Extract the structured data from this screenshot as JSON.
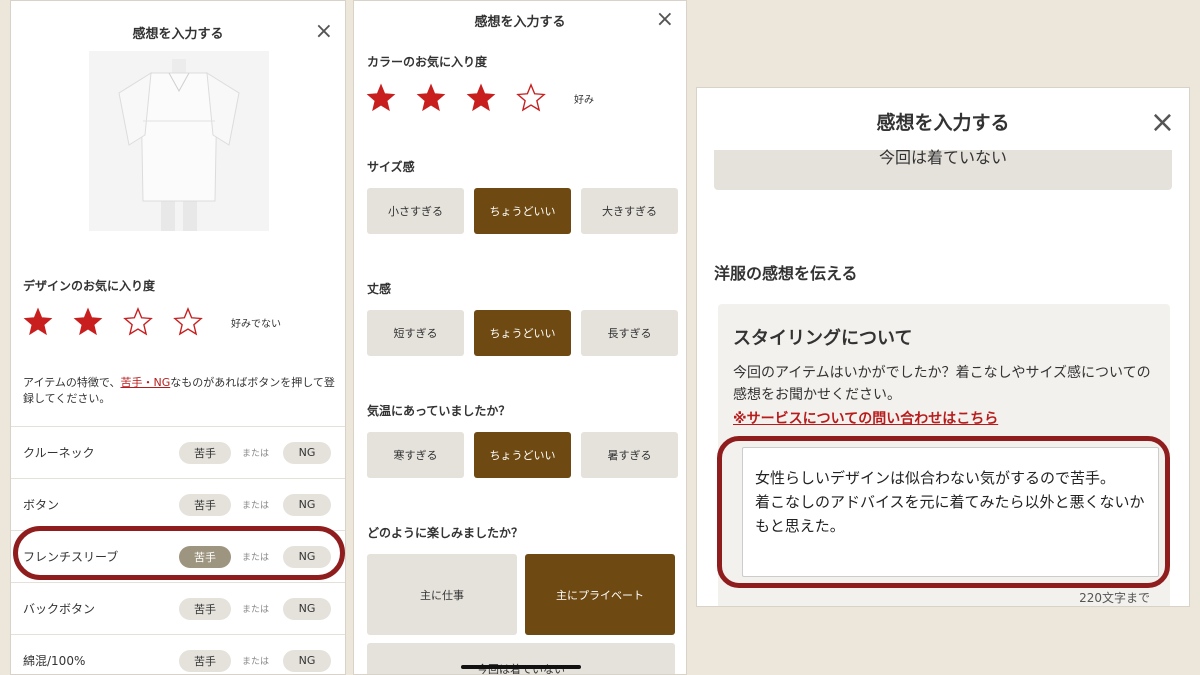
{
  "colors": {
    "background": "#ede6da",
    "star_red": "#c81e1e",
    "active_brown": "#6e4a12",
    "active_pill": "#9e9580",
    "highlight_outline": "#8f1d1d",
    "link_red": "#b71c1c"
  },
  "panel1": {
    "title": "感想を入力する",
    "close_icon": "×",
    "design_rating": {
      "label": "デザインのお気に入り度",
      "value": 2,
      "max": 4,
      "text": "好みでない"
    },
    "note": {
      "prefix": "アイテムの特徴で、",
      "link": "苦手・NG",
      "suffix": "なものがあればボタンを押して登録してください。"
    },
    "features": [
      {
        "name": "クルーネック",
        "nigate": "苦手",
        "or": "または",
        "ng": "NG",
        "selected": ""
      },
      {
        "name": "ボタン",
        "nigate": "苦手",
        "or": "または",
        "ng": "NG",
        "selected": ""
      },
      {
        "name": "フレンチスリーブ",
        "nigate": "苦手",
        "or": "または",
        "ng": "NG",
        "selected": "nigate"
      },
      {
        "name": "バックボタン",
        "nigate": "苦手",
        "or": "または",
        "ng": "NG",
        "selected": ""
      },
      {
        "name": "綿混/100%",
        "nigate": "苦手",
        "or": "または",
        "ng": "NG",
        "selected": ""
      }
    ]
  },
  "panel2": {
    "title": "感想を入力する",
    "close_icon": "×",
    "color_rating": {
      "label": "カラーのお気に入り度",
      "value": 3,
      "max": 4,
      "text": "好み"
    },
    "size": {
      "label": "サイズ感",
      "options": [
        "小さすぎる",
        "ちょうどいい",
        "大きすぎる"
      ],
      "selected": 1
    },
    "length": {
      "label": "丈感",
      "options": [
        "短すぎる",
        "ちょうどいい",
        "長すぎる"
      ],
      "selected": 1
    },
    "temperature": {
      "label": "気温にあっていましたか？",
      "options": [
        "寒すぎる",
        "ちょうどいい",
        "暑すぎる"
      ],
      "selected": 1
    },
    "enjoy": {
      "label": "どのように楽しみましたか？",
      "options": [
        "主に仕事",
        "主にプライベート"
      ],
      "selected": 1
    },
    "bottom_option": "今回は着ていない"
  },
  "panel3": {
    "title": "感想を入力する",
    "close_icon": "×",
    "top_option": "今回は着ていない",
    "section_title": "洋服の感想を伝える",
    "card_title": "スタイリングについて",
    "card_desc": "今回のアイテムはいかがでしたか？着こなしやサイズ感についての感想をお聞かせください。",
    "card_link": "※サービスについての問い合わせはこちら",
    "textarea_value": "女性らしいデザインは似合わない気がするので苦手。\n着こなしのアドバイスを元に着てみたら以外と悪くないかもと思えた。",
    "char_limit": "220文字まで"
  }
}
